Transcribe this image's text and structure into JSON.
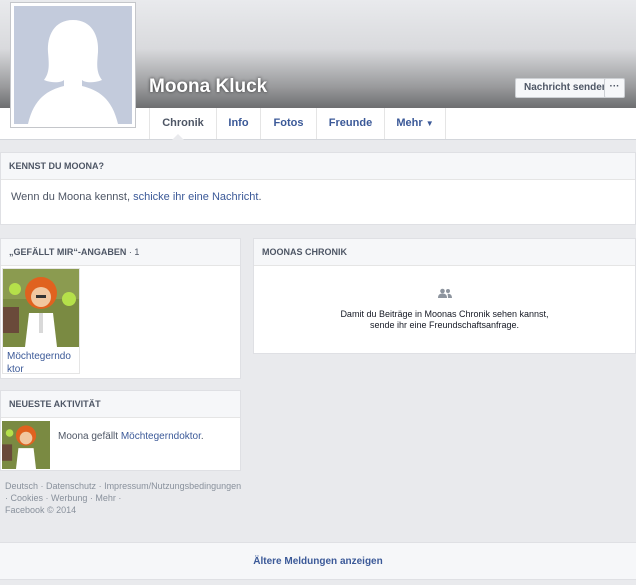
{
  "profile": {
    "name": "Moona Kluck",
    "message_button": "Nachricht senden",
    "more_button": "···"
  },
  "tabs": [
    {
      "label": "Chronik"
    },
    {
      "label": "Info"
    },
    {
      "label": "Fotos"
    },
    {
      "label": "Freunde"
    },
    {
      "label": "Mehr"
    }
  ],
  "know": {
    "title": "KENNST DU MOONA?",
    "text_before": "Wenn du Moona kennst, ",
    "link": "schicke ihr eine Nachricht",
    "text_after": "."
  },
  "likes": {
    "title": "„GEFÄLLT MIR“-ANGABEN",
    "count": "· 1",
    "items": [
      {
        "label": "Möchtegerndoktor"
      }
    ]
  },
  "activity": {
    "title": "NEUESTE AKTIVITÄT",
    "text": "Moona gefällt ",
    "link": "Möchtegerndoktor",
    "suffix": "."
  },
  "footer": {
    "links": [
      "Deutsch",
      "Datenschutz",
      "Impressum/Nutzungsbedingungen",
      "Cookies",
      "Werbung",
      "Mehr"
    ],
    "copyright": "Facebook © 2014"
  },
  "chronik": {
    "title": "MOONAS CHRONIK",
    "line1": "Damit du Beiträge in Moonas Chronik sehen kannst,",
    "line2": "sende ihr eine Freundschaftsanfrage."
  },
  "older": {
    "label": "Ältere Meldungen anzeigen"
  },
  "colors": {
    "link": "#3b5998",
    "avatar_bg": "#c3cbdc"
  }
}
